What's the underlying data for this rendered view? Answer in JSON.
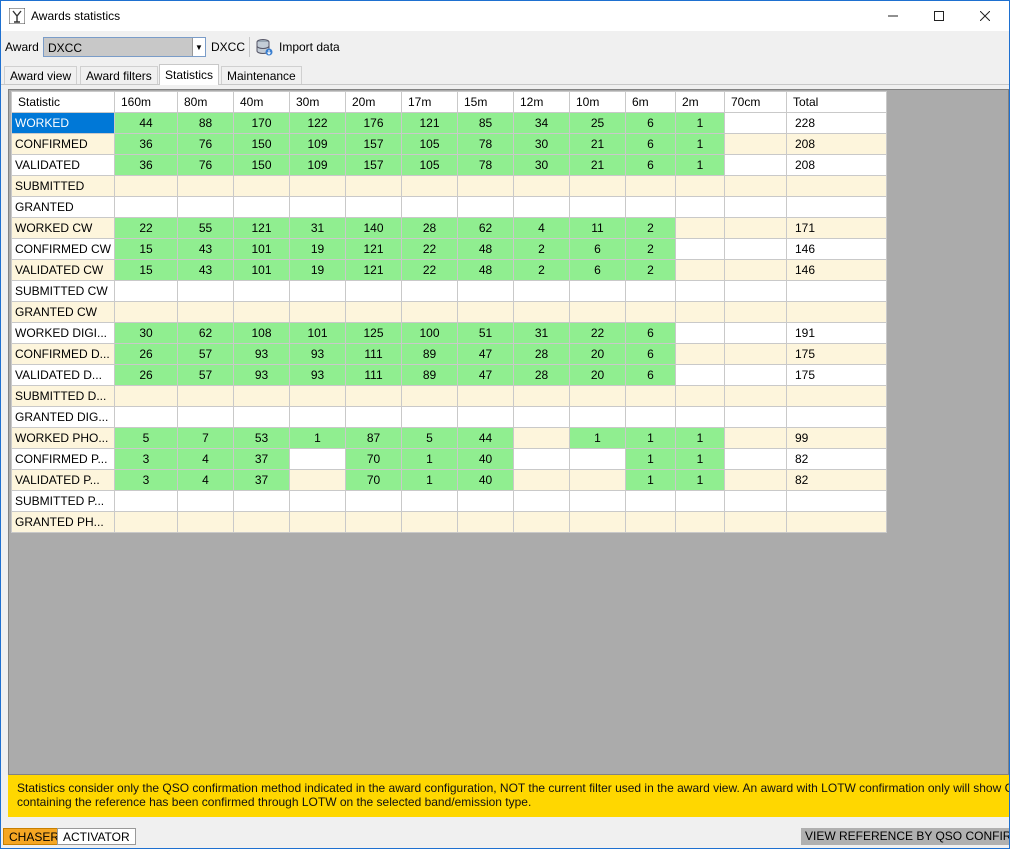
{
  "window": {
    "title": "Awards statistics"
  },
  "toolbar": {
    "award_label": "Award",
    "award_value": "DXCC",
    "award_name": "DXCC",
    "import_label": "Import data"
  },
  "tabs": [
    "Award view",
    "Award filters",
    "Statistics",
    "Maintenance"
  ],
  "active_tab": "Statistics",
  "table": {
    "headers": [
      "Statistic",
      "160m",
      "80m",
      "40m",
      "30m",
      "20m",
      "17m",
      "15m",
      "12m",
      "10m",
      "6m",
      "2m",
      "70cm",
      "Total"
    ],
    "rows": [
      {
        "label": "WORKED",
        "values": [
          "44",
          "88",
          "170",
          "122",
          "176",
          "121",
          "85",
          "34",
          "25",
          "6",
          "1",
          ""
        ],
        "green": [
          1,
          1,
          1,
          1,
          1,
          1,
          1,
          1,
          1,
          1,
          1,
          0
        ],
        "total": "228"
      },
      {
        "label": "CONFIRMED",
        "values": [
          "36",
          "76",
          "150",
          "109",
          "157",
          "105",
          "78",
          "30",
          "21",
          "6",
          "1",
          ""
        ],
        "green": [
          1,
          1,
          1,
          1,
          1,
          1,
          1,
          1,
          1,
          1,
          1,
          0
        ],
        "total": "208"
      },
      {
        "label": "VALIDATED",
        "values": [
          "36",
          "76",
          "150",
          "109",
          "157",
          "105",
          "78",
          "30",
          "21",
          "6",
          "1",
          ""
        ],
        "green": [
          1,
          1,
          1,
          1,
          1,
          1,
          1,
          1,
          1,
          1,
          1,
          0
        ],
        "total": "208"
      },
      {
        "label": "SUBMITTED",
        "values": [
          "",
          "",
          "",
          "",
          "",
          "",
          "",
          "",
          "",
          "",
          "",
          ""
        ],
        "green": [
          0,
          0,
          0,
          0,
          0,
          0,
          0,
          0,
          0,
          0,
          0,
          0
        ],
        "total": ""
      },
      {
        "label": "GRANTED",
        "values": [
          "",
          "",
          "",
          "",
          "",
          "",
          "",
          "",
          "",
          "",
          "",
          ""
        ],
        "green": [
          0,
          0,
          0,
          0,
          0,
          0,
          0,
          0,
          0,
          0,
          0,
          0
        ],
        "total": ""
      },
      {
        "label": "WORKED CW",
        "values": [
          "22",
          "55",
          "121",
          "31",
          "140",
          "28",
          "62",
          "4",
          "11",
          "2",
          "",
          ""
        ],
        "green": [
          1,
          1,
          1,
          1,
          1,
          1,
          1,
          1,
          1,
          1,
          0,
          0
        ],
        "total": "171"
      },
      {
        "label": "CONFIRMED CW",
        "values": [
          "15",
          "43",
          "101",
          "19",
          "121",
          "22",
          "48",
          "2",
          "6",
          "2",
          "",
          ""
        ],
        "green": [
          1,
          1,
          1,
          1,
          1,
          1,
          1,
          1,
          1,
          1,
          0,
          0
        ],
        "total": "146"
      },
      {
        "label": "VALIDATED CW",
        "values": [
          "15",
          "43",
          "101",
          "19",
          "121",
          "22",
          "48",
          "2",
          "6",
          "2",
          "",
          ""
        ],
        "green": [
          1,
          1,
          1,
          1,
          1,
          1,
          1,
          1,
          1,
          1,
          0,
          0
        ],
        "total": "146"
      },
      {
        "label": "SUBMITTED CW",
        "values": [
          "",
          "",
          "",
          "",
          "",
          "",
          "",
          "",
          "",
          "",
          "",
          ""
        ],
        "green": [
          0,
          0,
          0,
          0,
          0,
          0,
          0,
          0,
          0,
          0,
          0,
          0
        ],
        "total": ""
      },
      {
        "label": "GRANTED CW",
        "values": [
          "",
          "",
          "",
          "",
          "",
          "",
          "",
          "",
          "",
          "",
          "",
          ""
        ],
        "green": [
          0,
          0,
          0,
          0,
          0,
          0,
          0,
          0,
          0,
          0,
          0,
          0
        ],
        "total": ""
      },
      {
        "label": "WORKED DIGI...",
        "values": [
          "30",
          "62",
          "108",
          "101",
          "125",
          "100",
          "51",
          "31",
          "22",
          "6",
          "",
          ""
        ],
        "green": [
          1,
          1,
          1,
          1,
          1,
          1,
          1,
          1,
          1,
          1,
          0,
          0
        ],
        "total": "191"
      },
      {
        "label": "CONFIRMED D...",
        "values": [
          "26",
          "57",
          "93",
          "93",
          "111",
          "89",
          "47",
          "28",
          "20",
          "6",
          "",
          ""
        ],
        "green": [
          1,
          1,
          1,
          1,
          1,
          1,
          1,
          1,
          1,
          1,
          0,
          0
        ],
        "total": "175"
      },
      {
        "label": "VALIDATED D...",
        "values": [
          "26",
          "57",
          "93",
          "93",
          "111",
          "89",
          "47",
          "28",
          "20",
          "6",
          "",
          ""
        ],
        "green": [
          1,
          1,
          1,
          1,
          1,
          1,
          1,
          1,
          1,
          1,
          0,
          0
        ],
        "total": "175"
      },
      {
        "label": "SUBMITTED D...",
        "values": [
          "",
          "",
          "",
          "",
          "",
          "",
          "",
          "",
          "",
          "",
          "",
          ""
        ],
        "green": [
          0,
          0,
          0,
          0,
          0,
          0,
          0,
          0,
          0,
          0,
          0,
          0
        ],
        "total": ""
      },
      {
        "label": "GRANTED DIG...",
        "values": [
          "",
          "",
          "",
          "",
          "",
          "",
          "",
          "",
          "",
          "",
          "",
          ""
        ],
        "green": [
          0,
          0,
          0,
          0,
          0,
          0,
          0,
          0,
          0,
          0,
          0,
          0
        ],
        "total": ""
      },
      {
        "label": "WORKED PHO...",
        "values": [
          "5",
          "7",
          "53",
          "1",
          "87",
          "5",
          "44",
          "",
          "1",
          "1",
          "1",
          ""
        ],
        "green": [
          1,
          1,
          1,
          1,
          1,
          1,
          1,
          0,
          1,
          1,
          1,
          0
        ],
        "total": "99"
      },
      {
        "label": "CONFIRMED P...",
        "values": [
          "3",
          "4",
          "37",
          "",
          "70",
          "1",
          "40",
          "",
          "",
          "1",
          "1",
          ""
        ],
        "green": [
          1,
          1,
          1,
          0,
          1,
          1,
          1,
          0,
          0,
          1,
          1,
          0
        ],
        "total": "82"
      },
      {
        "label": "VALIDATED P...",
        "values": [
          "3",
          "4",
          "37",
          "",
          "70",
          "1",
          "40",
          "",
          "",
          "1",
          "1",
          ""
        ],
        "green": [
          1,
          1,
          1,
          0,
          1,
          1,
          1,
          0,
          0,
          1,
          1,
          0
        ],
        "total": "82"
      },
      {
        "label": "SUBMITTED P...",
        "values": [
          "",
          "",
          "",
          "",
          "",
          "",
          "",
          "",
          "",
          "",
          "",
          ""
        ],
        "green": [
          0,
          0,
          0,
          0,
          0,
          0,
          0,
          0,
          0,
          0,
          0,
          0
        ],
        "total": ""
      },
      {
        "label": "GRANTED PH...",
        "values": [
          "",
          "",
          "",
          "",
          "",
          "",
          "",
          "",
          "",
          "",
          "",
          ""
        ],
        "green": [
          0,
          0,
          0,
          0,
          0,
          0,
          0,
          0,
          0,
          0,
          0,
          0
        ],
        "total": ""
      }
    ]
  },
  "info": {
    "text": "Statistics consider only the QSO confirmation method indicated in the award configuration, NOT the current filter used in the award view. An award with LOTW confirmation only will show CONFIRMED status only if a QSO containing the reference has been confirmed through LOTW on the selected band/emission type."
  },
  "status": {
    "chaser": "CHASER",
    "activator": "ACTIVATOR",
    "view_reference": "VIEW REFERENCE BY QSO CONFIRMATION"
  },
  "colors": {
    "green_cell": "#90ee90",
    "even_row": "#fdf5dc",
    "selected": "#0078d7",
    "info_bar": "#ffd700",
    "chaser": "#f5a623"
  }
}
